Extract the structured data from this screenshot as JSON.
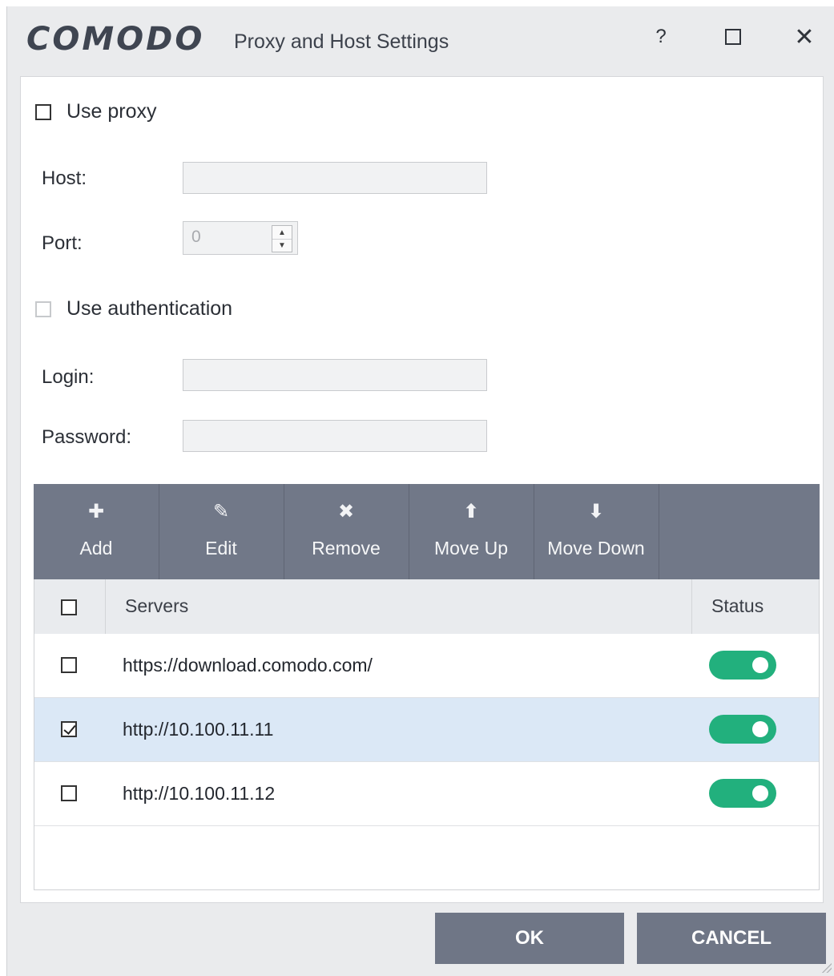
{
  "titlebar": {
    "logo": "COMODO",
    "title": "Proxy and Host Settings",
    "help_glyph": "?",
    "close_glyph": "✕"
  },
  "proxy": {
    "use_proxy_label": "Use proxy",
    "use_proxy_checked": false,
    "host_label": "Host:",
    "host_value": "",
    "port_label": "Port:",
    "port_value": "0",
    "use_auth_label": "Use authentication",
    "use_auth_checked": false,
    "login_label": "Login:",
    "login_value": "",
    "password_label": "Password:",
    "password_value": ""
  },
  "toolbar": {
    "items": [
      {
        "label": "Add",
        "icon": "plus-icon",
        "glyph": "✚"
      },
      {
        "label": "Edit",
        "icon": "pencil-icon",
        "glyph": "✎"
      },
      {
        "label": "Remove",
        "icon": "remove-icon",
        "glyph": "✖"
      },
      {
        "label": "Move Up",
        "icon": "arrow-up-icon",
        "glyph": "⬆"
      },
      {
        "label": "Move Down",
        "icon": "arrow-down-icon",
        "glyph": "⬇"
      }
    ]
  },
  "table": {
    "headers": {
      "servers": "Servers",
      "status": "Status"
    },
    "rows": [
      {
        "server": "https://download.comodo.com/",
        "checked": false,
        "status_on": true,
        "selected": false
      },
      {
        "server": "http://10.100.11.11",
        "checked": true,
        "status_on": true,
        "selected": true
      },
      {
        "server": "http://10.100.11.12",
        "checked": false,
        "status_on": true,
        "selected": false
      }
    ]
  },
  "buttons": {
    "ok": "OK",
    "cancel": "CANCEL"
  },
  "colors": {
    "toolbar": "#717888",
    "toggle_on": "#22b07d",
    "selected_row": "#dbe8f6",
    "button": "#6f7686"
  }
}
